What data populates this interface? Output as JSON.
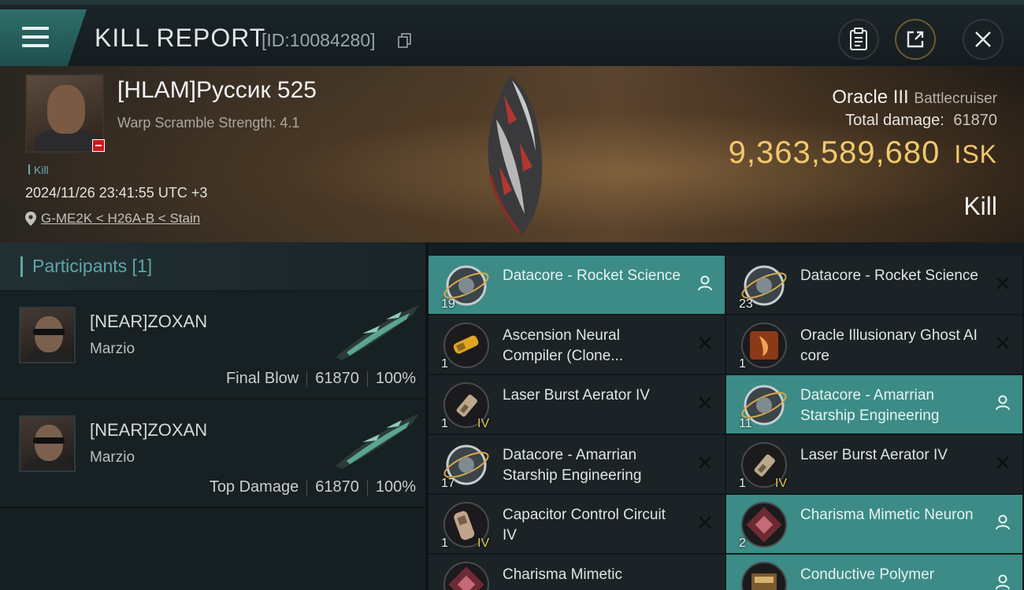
{
  "header": {
    "title": "KILL REPORT",
    "kill_id": "[ID:10084280]"
  },
  "victim": {
    "name": "[HLAM]Руссик 525",
    "subtitle": "Warp Scramble Strength: 4.1",
    "tag": "Kill",
    "timestamp": "2024/11/26 23:41:55 UTC +3",
    "location": "G-ME2K < H26A-B < Stain",
    "ship_name": "Oracle III",
    "ship_class": "Battlecruiser",
    "total_damage_label": "Total damage:",
    "total_damage": "61870",
    "isk_value": "9,363,589,680",
    "isk_unit": "ISK",
    "result": "Kill"
  },
  "participants": {
    "header": "Participants [1]",
    "list": [
      {
        "name": "[NEAR]ZOXAN",
        "ship": "Marzio",
        "role": "Final Blow",
        "damage": "61870",
        "percent": "100%"
      },
      {
        "name": "[NEAR]ZOXAN",
        "ship": "Marzio",
        "role": "Top Damage",
        "damage": "61870",
        "percent": "100%"
      }
    ]
  },
  "items": [
    {
      "label": "Datacore - Rocket Science",
      "qty": "19",
      "meta": "",
      "state": "person",
      "highlighted": true,
      "icon": "datacore-icon"
    },
    {
      "label": "Datacore - Rocket Science",
      "qty": "23",
      "meta": "",
      "state": "x",
      "highlighted": false,
      "icon": "datacore-icon"
    },
    {
      "label": "Ascension Neural Compiler (Clone...",
      "qty": "1",
      "meta": "",
      "state": "x",
      "highlighted": false,
      "icon": "compiler-icon"
    },
    {
      "label": "Oracle Illusionary Ghost AI core",
      "qty": "1",
      "meta": "",
      "state": "x",
      "highlighted": false,
      "icon": "ai-core-icon"
    },
    {
      "label": "Laser Burst Aerator IV",
      "qty": "1",
      "meta": "IV",
      "state": "x",
      "highlighted": false,
      "icon": "aerator-icon"
    },
    {
      "label": "Datacore - Amarrian Starship Engineering",
      "qty": "11",
      "meta": "",
      "state": "person",
      "highlighted": true,
      "icon": "datacore-icon"
    },
    {
      "label": "Datacore - Amarrian Starship Engineering",
      "qty": "17",
      "meta": "",
      "state": "x",
      "highlighted": false,
      "icon": "datacore-icon"
    },
    {
      "label": "Laser Burst Aerator IV",
      "qty": "1",
      "meta": "IV",
      "state": "x",
      "highlighted": false,
      "icon": "aerator-icon"
    },
    {
      "label": "Capacitor Control Circuit IV",
      "qty": "1",
      "meta": "IV",
      "state": "x",
      "highlighted": false,
      "icon": "circuit-icon"
    },
    {
      "label": "Charisma Mimetic Neuron",
      "qty": "2",
      "meta": "",
      "state": "person",
      "highlighted": true,
      "icon": "neuron-icon"
    },
    {
      "label": "Charisma Mimetic",
      "qty": "",
      "meta": "",
      "state": "",
      "highlighted": false,
      "icon": "neuron-icon"
    },
    {
      "label": "Conductive Polymer",
      "qty": "",
      "meta": "",
      "state": "person",
      "highlighted": true,
      "icon": "polymer-icon"
    }
  ],
  "colors": {
    "accent": "#3c8b86",
    "isk": "#f1c86b",
    "destroyed": "#c91a1a"
  }
}
